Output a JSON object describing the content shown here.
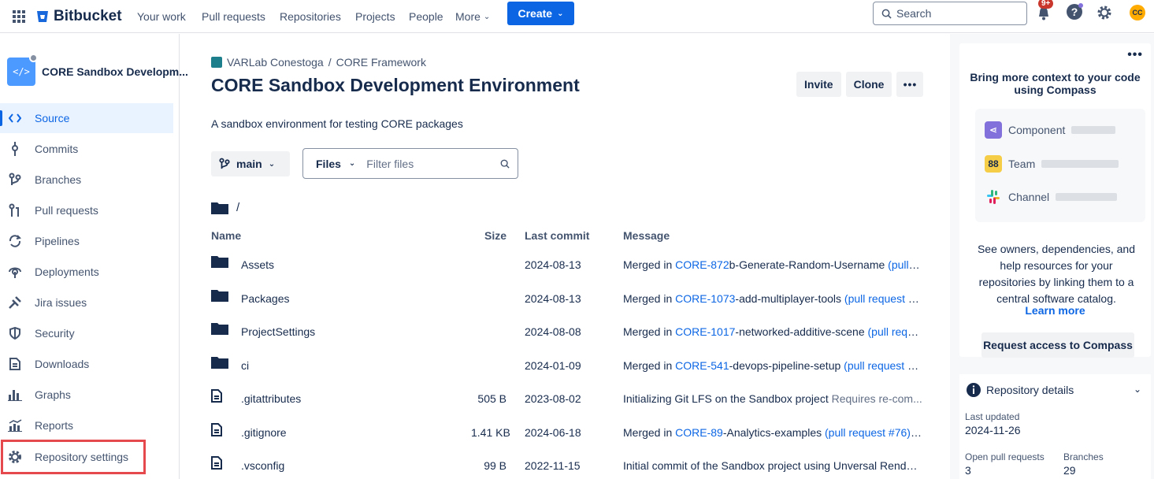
{
  "topnav": {
    "brand": "Bitbucket",
    "links": [
      "Your work",
      "Pull requests",
      "Repositories",
      "Projects",
      "People",
      "More"
    ],
    "create_label": "Create",
    "search_placeholder": "Search",
    "notif_badge": "9+",
    "avatar_initials": "CC"
  },
  "sidebar": {
    "repo_name": "CORE Sandbox Developm...",
    "repo_avatar_glyph": "</>",
    "items": [
      {
        "label": "Source",
        "icon": "code-icon"
      },
      {
        "label": "Commits",
        "icon": "commit-icon"
      },
      {
        "label": "Branches",
        "icon": "branch-icon"
      },
      {
        "label": "Pull requests",
        "icon": "pull-request-icon"
      },
      {
        "label": "Pipelines",
        "icon": "pipelines-icon"
      },
      {
        "label": "Deployments",
        "icon": "deployments-icon"
      },
      {
        "label": "Jira issues",
        "icon": "jira-icon"
      },
      {
        "label": "Security",
        "icon": "shield-icon"
      },
      {
        "label": "Downloads",
        "icon": "downloads-icon"
      },
      {
        "label": "Graphs",
        "icon": "graphs-icon"
      },
      {
        "label": "Reports",
        "icon": "reports-icon"
      },
      {
        "label": "Repository settings",
        "icon": "gear-icon"
      }
    ]
  },
  "main": {
    "breadcrumb": {
      "workspace": "VARLab Conestoga",
      "separator": "/",
      "project": "CORE Framework"
    },
    "title": "CORE Sandbox Development Environment",
    "invite_label": "Invite",
    "clone_label": "Clone",
    "more_label": "•••",
    "description": "A sandbox environment for testing CORE packages",
    "branch": "main",
    "files_label": "Files",
    "filter_placeholder": "Filter files",
    "path": "/",
    "columns": {
      "name": "Name",
      "size": "Size",
      "last_commit": "Last commit",
      "message": "Message"
    },
    "rows": [
      {
        "type": "folder",
        "name": "Assets",
        "size": "",
        "date": "2024-08-13",
        "msg_pre": "Merged in ",
        "msg_link": "CORE-872",
        "msg_mid": "b-Generate-Random-Username ",
        "msg_tail": "(pull re..."
      },
      {
        "type": "folder",
        "name": "Packages",
        "size": "",
        "date": "2024-08-13",
        "msg_pre": "Merged in ",
        "msg_link": "CORE-1073",
        "msg_mid": "-add-multiplayer-tools ",
        "msg_tail": "(pull request #..."
      },
      {
        "type": "folder",
        "name": "ProjectSettings",
        "size": "",
        "date": "2024-08-08",
        "msg_pre": "Merged in ",
        "msg_link": "CORE-1017",
        "msg_mid": "-networked-additive-scene ",
        "msg_tail": "(pull requ..."
      },
      {
        "type": "folder",
        "name": "ci",
        "size": "",
        "date": "2024-01-09",
        "msg_pre": "Merged in ",
        "msg_link": "CORE-541",
        "msg_mid": "-devops-pipeline-setup ",
        "msg_tail": "(pull request #..."
      },
      {
        "type": "file",
        "name": ".gitattributes",
        "size": "505 B",
        "date": "2023-08-02",
        "msg_pre": "Initializing Git LFS on the Sandbox project ",
        "msg_link": "",
        "msg_mid": "",
        "msg_tail": "Requires re-com..."
      },
      {
        "type": "file",
        "name": ".gitignore",
        "size": "1.41 KB",
        "date": "2024-06-18",
        "msg_pre": "Merged in ",
        "msg_link": "CORE-89",
        "msg_mid": "-Analytics-examples ",
        "msg_tail": "(pull request #76) I..."
      },
      {
        "type": "file",
        "name": ".vsconfig",
        "size": "99 B",
        "date": "2022-11-15",
        "msg_pre": "Initial commit of the Sandbox project using Unversal Render...",
        "msg_link": "",
        "msg_mid": "",
        "msg_tail": ""
      }
    ]
  },
  "right": {
    "compass_title": "Bring more context to your code using Compass",
    "items": [
      {
        "label": "Component",
        "color": "#8270db",
        "icon": "component-icon"
      },
      {
        "label": "Team",
        "color": "#f5cd47",
        "icon": "team-icon"
      },
      {
        "label": "Channel",
        "color": "#36c5f0",
        "icon": "slack-icon"
      }
    ],
    "compass_desc": "See owners, dependencies, and help resources for your repositories by linking them to a central software catalog.",
    "learn_more": "Learn more",
    "request_btn": "Request access to Compass",
    "details_title": "Repository details",
    "last_updated_label": "Last updated",
    "last_updated_value": "2024-11-26",
    "open_prs_label": "Open pull requests",
    "open_prs_value": "3",
    "branches_label": "Branches",
    "branches_value": "29"
  }
}
